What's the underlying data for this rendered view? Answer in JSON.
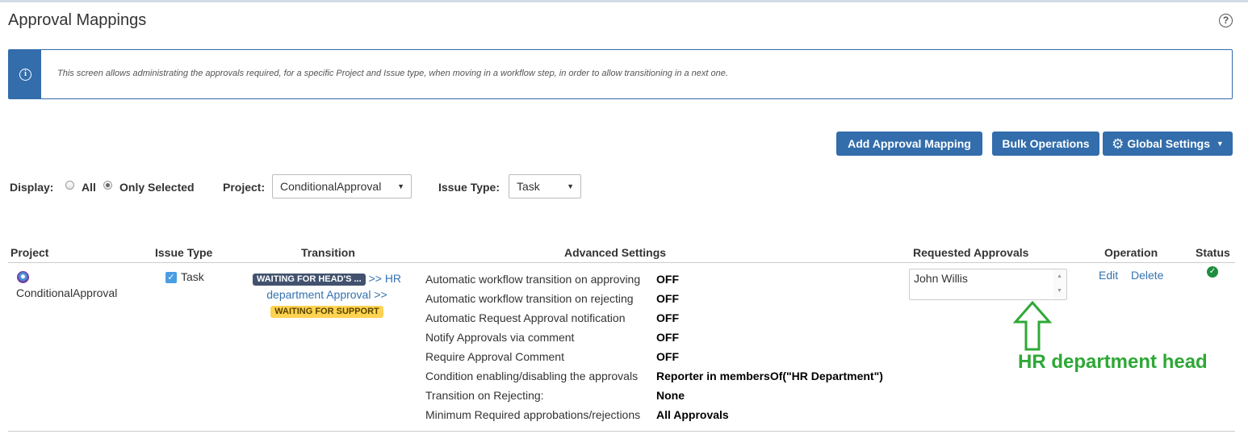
{
  "page": {
    "title": "Approval Mappings"
  },
  "info": {
    "text": "This screen allows administrating the approvals required, for a specific Project and Issue type, when moving in a workflow step, in order to allow transitioning in a next one."
  },
  "actions": {
    "add_label": "Add Approval Mapping",
    "bulk_label": "Bulk Operations",
    "global_label": "Global Settings"
  },
  "filters": {
    "display_label": "Display:",
    "all_label": "All",
    "only_selected_label": "Only Selected",
    "display_selected": "Only Selected",
    "project_label": "Project:",
    "project_value": "ConditionalApproval",
    "issue_type_label": "Issue Type:",
    "issue_type_value": "Task"
  },
  "table": {
    "headers": {
      "project": "Project",
      "issue_type": "Issue Type",
      "transition": "Transition",
      "advanced": "Advanced Settings",
      "requested": "Requested Approvals",
      "operation": "Operation",
      "status": "Status"
    },
    "row": {
      "project": "ConditionalApproval",
      "issue_type": "Task",
      "transition": {
        "from_status": "WAITING FOR HEAD'S ...",
        "sep1": ">>",
        "name": "HR department Approval",
        "sep2": ">>",
        "to_status": "WAITING FOR SUPPORT"
      },
      "settings": [
        {
          "label": "Automatic workflow transition on approving",
          "value": "OFF"
        },
        {
          "label": "Automatic workflow transition on rejecting",
          "value": "OFF"
        },
        {
          "label": "Automatic Request Approval notification",
          "value": "OFF"
        },
        {
          "label": "Notify Approvals via comment",
          "value": "OFF"
        },
        {
          "label": "Require Approval Comment",
          "value": "OFF"
        },
        {
          "label": "Condition enabling/disabling the approvals",
          "value": "Reporter in membersOf(\"HR Department\")"
        },
        {
          "label": "Transition on Rejecting:",
          "value": "None"
        },
        {
          "label": "Minimum Required approbations/rejections",
          "value": "All Approvals"
        }
      ],
      "requested_approvals": "John Willis",
      "edit_label": "Edit",
      "delete_label": "Delete",
      "status_color": "#1e8e3e"
    }
  },
  "annotation": {
    "text": "HR department head",
    "color": "#2ea836"
  },
  "colors": {
    "primary": "#336dab",
    "link": "#3572b0"
  }
}
